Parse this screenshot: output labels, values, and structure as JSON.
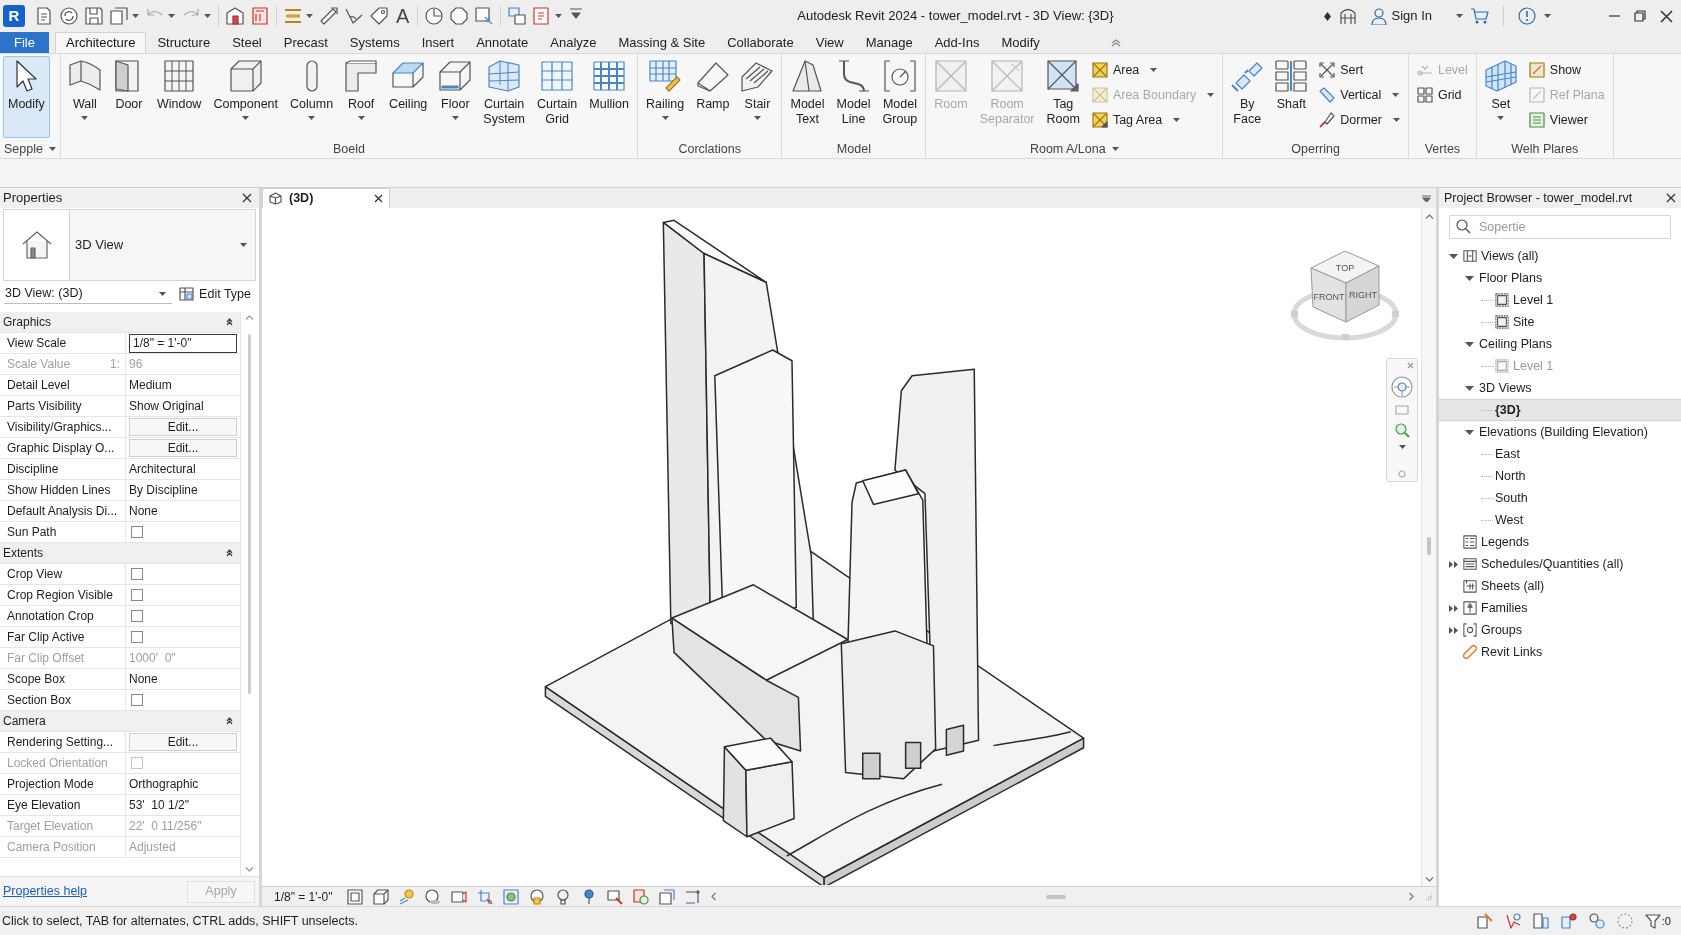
{
  "title_bar": {
    "logo": "R",
    "quick_access": {
      "text_tool": "A"
    },
    "title": "Autodesk Revit 2024 - tower_model.rvt - 3D View: {3D}",
    "sign_in": "Sign In"
  },
  "ribbon": {
    "file_tab": "File",
    "tabs": [
      {
        "label": "Architecture",
        "selected": true
      },
      {
        "label": "Structure",
        "selected": false
      },
      {
        "label": "Steel",
        "selected": false
      },
      {
        "label": "Precast",
        "selected": false
      },
      {
        "label": "Systems",
        "selected": false
      },
      {
        "label": "Insert",
        "selected": false
      },
      {
        "label": "Annotate",
        "selected": false
      },
      {
        "label": "Analyze",
        "selected": false
      },
      {
        "label": "Massing & Site",
        "selected": false
      },
      {
        "label": "Collaborate",
        "selected": false
      },
      {
        "label": "View",
        "selected": false
      },
      {
        "label": "Manage",
        "selected": false
      },
      {
        "label": "Add-Ins",
        "selected": false
      },
      {
        "label": "Modify",
        "selected": false
      }
    ],
    "panels": [
      {
        "title": "Sepple",
        "menu": true,
        "items": [
          {
            "kind": "large",
            "label": "Modify",
            "dropdown": false,
            "disabled": false,
            "selected": true
          }
        ]
      },
      {
        "title": "Boeld",
        "menu": false,
        "items": [
          {
            "kind": "large",
            "label": "Wall",
            "dropdown": true,
            "disabled": false,
            "selected": false
          },
          {
            "kind": "large",
            "label": "Door",
            "dropdown": false,
            "disabled": false,
            "selected": false
          },
          {
            "kind": "large",
            "label": "Window",
            "dropdown": false,
            "disabled": false,
            "selected": false
          },
          {
            "kind": "large",
            "label": "Component",
            "dropdown": true,
            "disabled": false,
            "selected": false
          },
          {
            "kind": "large",
            "label": "Column",
            "dropdown": true,
            "disabled": false,
            "selected": false
          },
          {
            "kind": "large",
            "label": "Roof",
            "dropdown": true,
            "disabled": false,
            "selected": false
          },
          {
            "kind": "large",
            "label": "Ceiling",
            "dropdown": false,
            "disabled": false,
            "selected": false
          },
          {
            "kind": "large",
            "label": "Floor",
            "dropdown": true,
            "disabled": false,
            "selected": false
          },
          {
            "kind": "large",
            "label": "Curtain System",
            "dropdown": false,
            "disabled": false,
            "selected": false
          },
          {
            "kind": "large",
            "label": "Curtain Grid",
            "dropdown": false,
            "disabled": false,
            "selected": false
          },
          {
            "kind": "large",
            "label": "Mullion",
            "dropdown": false,
            "disabled": false,
            "selected": false
          }
        ]
      },
      {
        "title": "Corclations",
        "menu": false,
        "items": [
          {
            "kind": "large",
            "label": "Railing",
            "dropdown": true,
            "disabled": false,
            "selected": false
          },
          {
            "kind": "large",
            "label": "Ramp",
            "dropdown": false,
            "disabled": false,
            "selected": false
          },
          {
            "kind": "large",
            "label": "Stair",
            "dropdown": true,
            "disabled": false,
            "selected": false
          }
        ]
      },
      {
        "title": "Model",
        "menu": false,
        "items": [
          {
            "kind": "large",
            "label": "Model Text",
            "dropdown": false,
            "disabled": false,
            "selected": false
          },
          {
            "kind": "large",
            "label": "Model Line",
            "dropdown": false,
            "disabled": false,
            "selected": false
          },
          {
            "kind": "large",
            "label": "Model Group",
            "dropdown": false,
            "disabled": false,
            "selected": false
          }
        ]
      },
      {
        "title": "Room A/Lona",
        "menu": true,
        "items": [
          {
            "kind": "large",
            "label": "Room",
            "dropdown": false,
            "disabled": true,
            "selected": false
          },
          {
            "kind": "large",
            "label": "Room Separator",
            "dropdown": false,
            "disabled": true,
            "selected": false
          },
          {
            "kind": "large",
            "label": "Tag Room",
            "dropdown": false,
            "disabled": false,
            "selected": false
          },
          {
            "kind": "stack",
            "items": [
              {
                "kind": "small",
                "label": "Area",
                "dropdown": true,
                "disabled": false,
                "selected": false
              },
              {
                "kind": "small",
                "label": "Area Boundary",
                "dropdown": true,
                "disabled": true,
                "selected": false
              },
              {
                "kind": "small",
                "label": "Tag Area",
                "dropdown": true,
                "disabled": false,
                "selected": false
              }
            ]
          }
        ]
      },
      {
        "title": "Operring",
        "menu": false,
        "items": [
          {
            "kind": "large",
            "label": "By Face",
            "dropdown": false,
            "disabled": false,
            "selected": false
          },
          {
            "kind": "large",
            "label": "Shaft",
            "dropdown": false,
            "disabled": false,
            "selected": false
          },
          {
            "kind": "stack",
            "items": [
              {
                "kind": "small",
                "label": "Sert",
                "dropdown": false,
                "disabled": false,
                "selected": false
              },
              {
                "kind": "small",
                "label": "Vertical",
                "dropdown": true,
                "disabled": false,
                "selected": false
              },
              {
                "kind": "small",
                "label": "Dormer",
                "dropdown": true,
                "disabled": false,
                "selected": false
              }
            ]
          }
        ]
      },
      {
        "title": "Vertes",
        "menu": false,
        "items": [
          {
            "kind": "stack",
            "items": [
              {
                "kind": "small",
                "label": "Level",
                "dropdown": false,
                "disabled": true,
                "selected": false
              },
              {
                "kind": "small",
                "label": "Grid",
                "dropdown": false,
                "disabled": false,
                "selected": false
              }
            ]
          }
        ]
      },
      {
        "title": "Welh Plares",
        "menu": false,
        "items": [
          {
            "kind": "large",
            "label": "Set",
            "dropdown": true,
            "disabled": false,
            "selected": false
          },
          {
            "kind": "stack",
            "items": [
              {
                "kind": "small",
                "label": "Show",
                "dropdown": false,
                "disabled": false,
                "selected": false
              },
              {
                "kind": "small",
                "label": "Ref Plana",
                "dropdown": false,
                "disabled": true,
                "selected": false
              },
              {
                "kind": "small",
                "label": "Viewer",
                "dropdown": false,
                "disabled": false,
                "selected": false
              }
            ]
          }
        ]
      }
    ]
  },
  "properties": {
    "title": "Properties",
    "type_name": "3D View",
    "instance": "3D View: (3D)",
    "edit_type": "Edit Type",
    "groups": [
      {
        "name": "Graphics",
        "expanded": true,
        "rows": [
          {
            "label": "View Scale",
            "kind": "field",
            "value": "1/8\" = 1'-0\"",
            "disabled": false
          },
          {
            "label": "Scale Value",
            "unit": "1:",
            "kind": "text",
            "value": "96",
            "disabled": true
          },
          {
            "label": "Detail Level",
            "kind": "text",
            "value": "Medium",
            "disabled": false
          },
          {
            "label": "Parts Visibility",
            "kind": "text",
            "value": "Show Original",
            "disabled": false
          },
          {
            "label": "Visibility/Graphics...",
            "kind": "button",
            "value": "Edit...",
            "disabled": false
          },
          {
            "label": "Graphic Display O...",
            "kind": "button",
            "value": "Edit...",
            "disabled": false
          },
          {
            "label": "Discipline",
            "kind": "text",
            "value": "Architectural",
            "disabled": false
          },
          {
            "label": "Show Hidden Lines",
            "kind": "text",
            "value": "By Discipline",
            "disabled": false
          },
          {
            "label": "Default Analysis Di...",
            "kind": "text",
            "value": "None",
            "disabled": false
          },
          {
            "label": "Sun Path",
            "kind": "checkbox",
            "checked": false,
            "disabled": false
          }
        ]
      },
      {
        "name": "Extents",
        "expanded": true,
        "rows": [
          {
            "label": "Crop View",
            "kind": "checkbox",
            "checked": false,
            "disabled": false
          },
          {
            "label": "Crop Region Visible",
            "kind": "checkbox",
            "checked": false,
            "disabled": false
          },
          {
            "label": "Annotation Crop",
            "kind": "checkbox",
            "checked": false,
            "disabled": false
          },
          {
            "label": "Far Clip Active",
            "kind": "checkbox",
            "checked": false,
            "disabled": false
          },
          {
            "label": "Far Clip Offset",
            "kind": "text",
            "value": "1000'  0\"",
            "disabled": true
          },
          {
            "label": "Scope Box",
            "kind": "text",
            "value": "None",
            "disabled": false
          },
          {
            "label": "Section Box",
            "kind": "checkbox",
            "checked": false,
            "disabled": false
          }
        ]
      },
      {
        "name": "Camera",
        "expanded": true,
        "rows": [
          {
            "label": "Rendering Setting...",
            "kind": "button",
            "value": "Edit...",
            "disabled": false
          },
          {
            "label": "Locked Orientation",
            "kind": "checkbox",
            "checked": false,
            "disabled": true
          },
          {
            "label": "Projection Mode",
            "kind": "text",
            "value": "Orthographic",
            "disabled": false
          },
          {
            "label": "Eye Elevation",
            "kind": "text",
            "value": "53'  10 1/2\"",
            "disabled": false
          },
          {
            "label": "Target Elevation",
            "kind": "text",
            "value": "22'  0 11/256\"",
            "disabled": true
          },
          {
            "label": "Camera Position",
            "kind": "text",
            "value": "Adjusted",
            "disabled": true
          }
        ]
      }
    ],
    "help_link": "Properties help",
    "apply": "Apply",
    "apply_disabled": true
  },
  "view": {
    "tab_label": "(3D)",
    "viewcube": {
      "top": "TOP",
      "front": "FRONT",
      "right": "RIGHT"
    },
    "scale": "1/8\" = 1'-0\""
  },
  "browser": {
    "title": "Project Browser - tower_model.rvt",
    "search_placeholder": "Sopertie",
    "tree": [
      {
        "label": "Views (all)",
        "kind": "views",
        "expanded": true,
        "selected": false,
        "dimmed": false,
        "children": [
          {
            "label": "Floor Plans",
            "expanded": true,
            "selected": false,
            "dimmed": false,
            "children": [
              {
                "label": "Level 1",
                "kind": "plan",
                "selected": false,
                "dimmed": false
              },
              {
                "label": "Site",
                "kind": "plan",
                "selected": false,
                "dimmed": false
              }
            ]
          },
          {
            "label": "Ceiling Plans",
            "expanded": true,
            "selected": false,
            "dimmed": false,
            "children": [
              {
                "label": "Level 1",
                "kind": "plan",
                "selected": false,
                "dimmed": true
              }
            ]
          },
          {
            "label": "3D Views",
            "expanded": true,
            "selected": false,
            "dimmed": false,
            "children": [
              {
                "label": "{3D}",
                "selected": true,
                "dimmed": false
              }
            ]
          },
          {
            "label": "Elevations (Building Elevation)",
            "expanded": true,
            "selected": false,
            "dimmed": false,
            "children": [
              {
                "label": "East",
                "selected": false,
                "dimmed": false
              },
              {
                "label": "North",
                "selected": false,
                "dimmed": false
              },
              {
                "label": "South",
                "selected": false,
                "dimmed": false
              },
              {
                "label": "West",
                "selected": false,
                "dimmed": false
              }
            ]
          }
        ]
      },
      {
        "label": "Legends",
        "kind": "legends",
        "selected": false,
        "dimmed": false
      },
      {
        "label": "Schedules/Quantities (all)",
        "kind": "schedules",
        "expanded": false,
        "selected": false,
        "dimmed": false
      },
      {
        "label": "Sheets (all)",
        "kind": "sheets",
        "selected": false,
        "dimmed": false
      },
      {
        "label": "Families",
        "kind": "families",
        "expanded": false,
        "selected": false,
        "dimmed": false
      },
      {
        "label": "Groups",
        "kind": "groups",
        "expanded": false,
        "selected": false,
        "dimmed": false
      },
      {
        "label": "Revit Links",
        "kind": "links",
        "selected": false,
        "dimmed": false
      }
    ]
  },
  "status_bar": {
    "message": "Click to select, TAB for alternates, CTRL adds, SHIFT unselects.",
    "filter_count": ":0"
  }
}
